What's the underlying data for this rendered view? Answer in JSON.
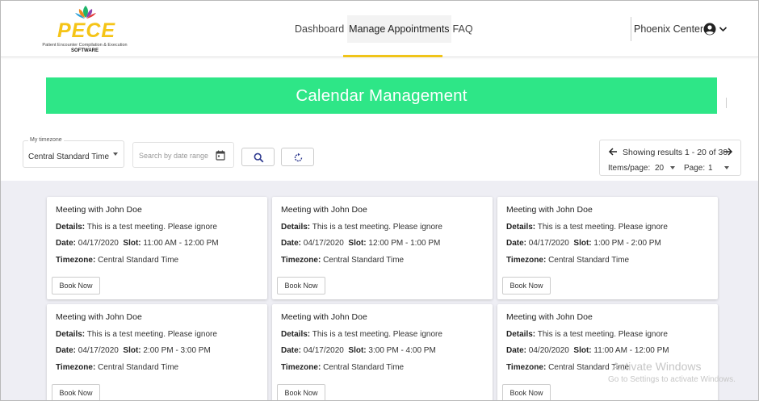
{
  "brand": {
    "logo_text": "PECE",
    "logo_subtitle": "Patient Encounter Compilation & Execution",
    "logo_software": "SOFTWARE",
    "accent_yellow": "#f0c419",
    "accent_green": "#2ee687"
  },
  "nav": {
    "items": [
      {
        "label": "Dashboard"
      },
      {
        "label": "Manage Appointments",
        "active": true
      },
      {
        "label": "FAQ"
      }
    ]
  },
  "user": {
    "name": "Phoenix Center",
    "icon": "account-circle-icon"
  },
  "banner": {
    "title": "Calendar Management"
  },
  "toolbar": {
    "timezone_label": "My timezone",
    "timezone_value": "Central Standard Time",
    "date_placeholder": "Search by date range",
    "search_icon": "search-icon",
    "refresh_icon": "refresh-icon"
  },
  "pager": {
    "showing_text": "Showing results 1 - 20 of 30",
    "items_per_page_label": "Items/page:",
    "items_per_page_value": "20",
    "page_label": "Page:",
    "page_value": "1"
  },
  "cards": [
    {
      "title": "Meeting with John Doe",
      "details_label": "Details:",
      "details": "This is a test meeting. Please ignore",
      "date_label": "Date:",
      "date": "04/17/2020",
      "slot_label": "Slot:",
      "slot": "11:00 AM - 12:00 PM",
      "tz_label": "Timezone:",
      "tz": "Central Standard Time",
      "button": "Book Now"
    },
    {
      "title": "Meeting with John Doe",
      "details_label": "Details:",
      "details": "This is a test meeting. Please ignore",
      "date_label": "Date:",
      "date": "04/17/2020",
      "slot_label": "Slot:",
      "slot": "12:00 PM - 1:00 PM",
      "tz_label": "Timezone:",
      "tz": "Central Standard Time",
      "button": "Book Now"
    },
    {
      "title": "Meeting with John Doe",
      "details_label": "Details:",
      "details": "This is a test meeting. Please ignore",
      "date_label": "Date:",
      "date": "04/17/2020",
      "slot_label": "Slot:",
      "slot": "1:00 PM - 2:00 PM",
      "tz_label": "Timezone:",
      "tz": "Central Standard Time",
      "button": "Book Now"
    },
    {
      "title": "Meeting with John Doe",
      "details_label": "Details:",
      "details": "This is a test meeting. Please ignore",
      "date_label": "Date:",
      "date": "04/17/2020",
      "slot_label": "Slot:",
      "slot": "2:00 PM - 3:00 PM",
      "tz_label": "Timezone:",
      "tz": "Central Standard Time",
      "button": "Book Now"
    },
    {
      "title": "Meeting with John Doe",
      "details_label": "Details:",
      "details": "This is a test meeting. Please ignore",
      "date_label": "Date:",
      "date": "04/17/2020",
      "slot_label": "Slot:",
      "slot": "3:00 PM - 4:00 PM",
      "tz_label": "Timezone:",
      "tz": "Central Standard Time",
      "button": "Book Now"
    },
    {
      "title": "Meeting with John Doe",
      "details_label": "Details:",
      "details": "This is a test meeting. Please ignore",
      "date_label": "Date:",
      "date": "04/20/2020",
      "slot_label": "Slot:",
      "slot": "11:00 AM - 12:00 PM",
      "tz_label": "Timezone:",
      "tz": "Central Standard Time",
      "button": "Book Now"
    }
  ],
  "watermark": {
    "line1": "Activate Windows",
    "line2": "Go to Settings to activate Windows."
  }
}
